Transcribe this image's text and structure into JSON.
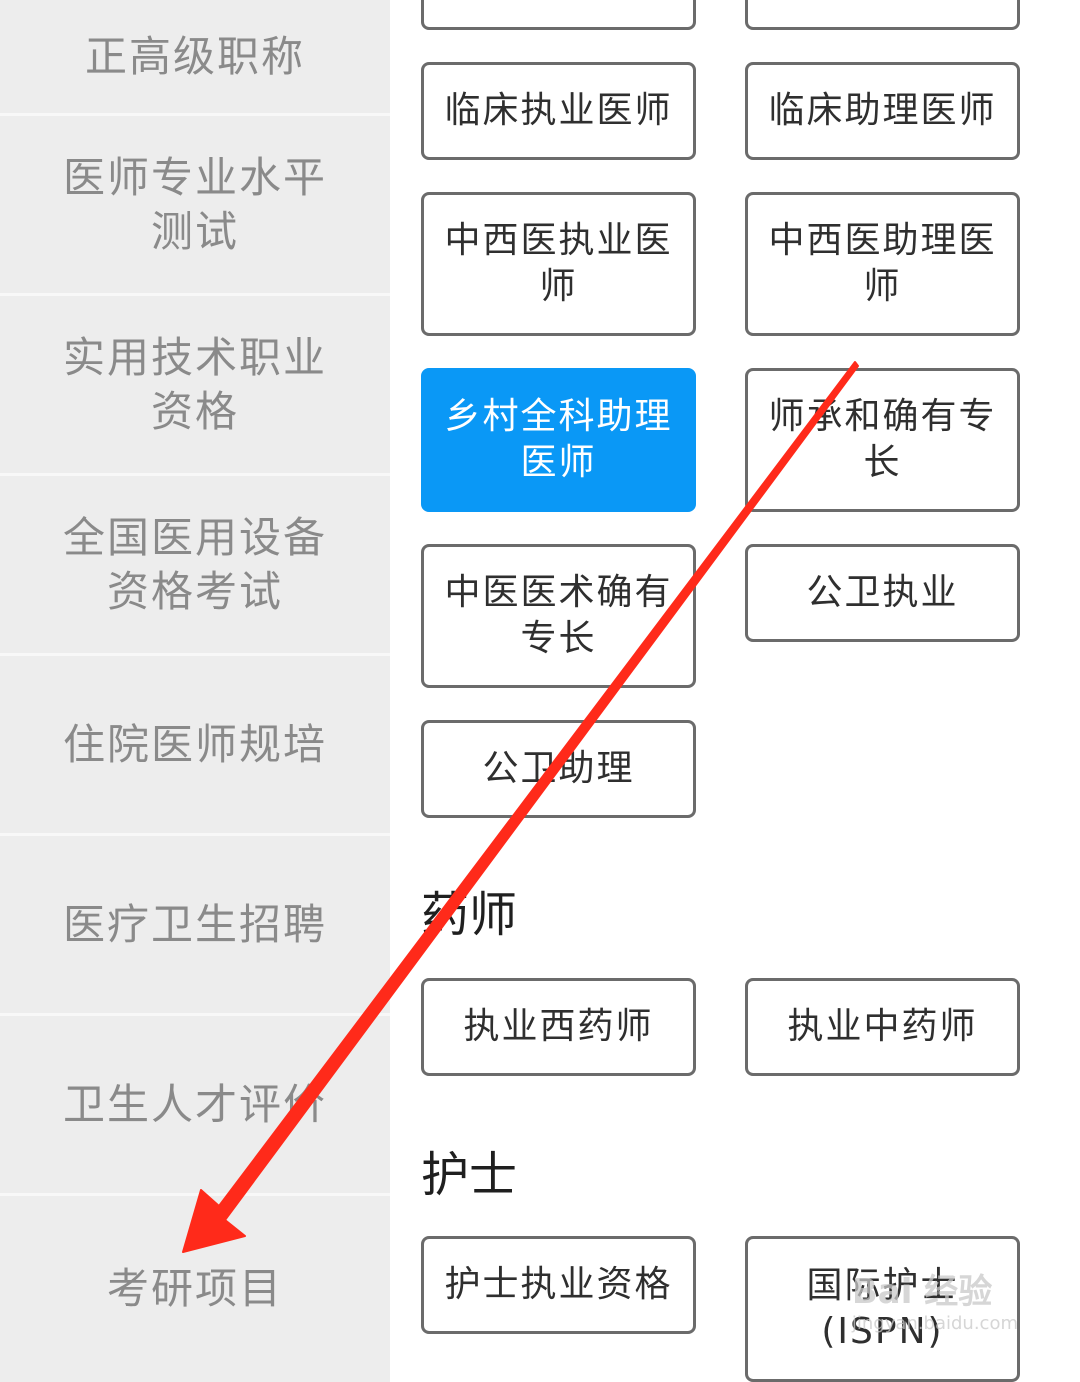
{
  "sidebar": {
    "items": [
      {
        "label": "正高级职称"
      },
      {
        "label": "医师专业水平测试"
      },
      {
        "label": "实用技术职业资格"
      },
      {
        "label": "全国医用设备资格考试"
      },
      {
        "label": "住院医师规培"
      },
      {
        "label": "医疗卫生招聘"
      },
      {
        "label": "卫生人才评价"
      },
      {
        "label": "考研项目"
      }
    ]
  },
  "physician": {
    "options": [
      {
        "label": "临床执业医师"
      },
      {
        "label": "临床助理医师"
      },
      {
        "label": "中西医执业医师"
      },
      {
        "label": "中西医助理医师"
      },
      {
        "label": "乡村全科助理医师",
        "selected": true
      },
      {
        "label": "师承和确有专长"
      },
      {
        "label": "中医医术确有专长"
      },
      {
        "label": "公卫执业"
      },
      {
        "label": "公卫助理"
      }
    ]
  },
  "pharmacist": {
    "title": "药师",
    "options": [
      {
        "label": "执业西药师"
      },
      {
        "label": "执业中药师"
      }
    ]
  },
  "nurse": {
    "title": "护士",
    "options": [
      {
        "label": "护士执业资格"
      },
      {
        "label": "国际护士(ISPN)"
      }
    ]
  },
  "annotation": {
    "color": "#ff2a1a"
  },
  "watermark": {
    "text": "Bai 经验",
    "url": "jingyan.baidu.com"
  }
}
